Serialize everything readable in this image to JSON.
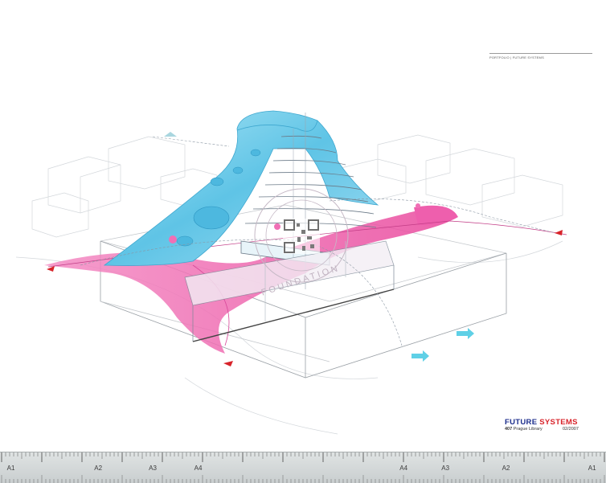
{
  "header": {
    "text": "PORTFOLIO | FUTURE SYSTEMS"
  },
  "watermark": {
    "text": "FOUNDATION"
  },
  "title_block": {
    "brand_word_1": "FUTURE",
    "brand_word_2": "SYSTEMS",
    "project_number": "407",
    "project_name": "Prague Library",
    "date": "02/2007",
    "brand_color_1": "#1c2e8c",
    "brand_color_2": "#d8232a"
  },
  "ruler": {
    "labels": [
      {
        "text": "A1",
        "pos": 0.018
      },
      {
        "text": "A2",
        "pos": 0.162
      },
      {
        "text": "A3",
        "pos": 0.252
      },
      {
        "text": "A4",
        "pos": 0.327
      },
      {
        "text": "A4",
        "pos": 0.666
      },
      {
        "text": "A3",
        "pos": 0.735
      },
      {
        "text": "A2",
        "pos": 0.835
      },
      {
        "text": "A1",
        "pos": 0.977
      }
    ]
  },
  "colors": {
    "canopy_blue": "#7fd3ec",
    "ramp_pink": "#f05aa8",
    "line_gray": "#b9bec4",
    "arrow_red": "#d8232a"
  }
}
